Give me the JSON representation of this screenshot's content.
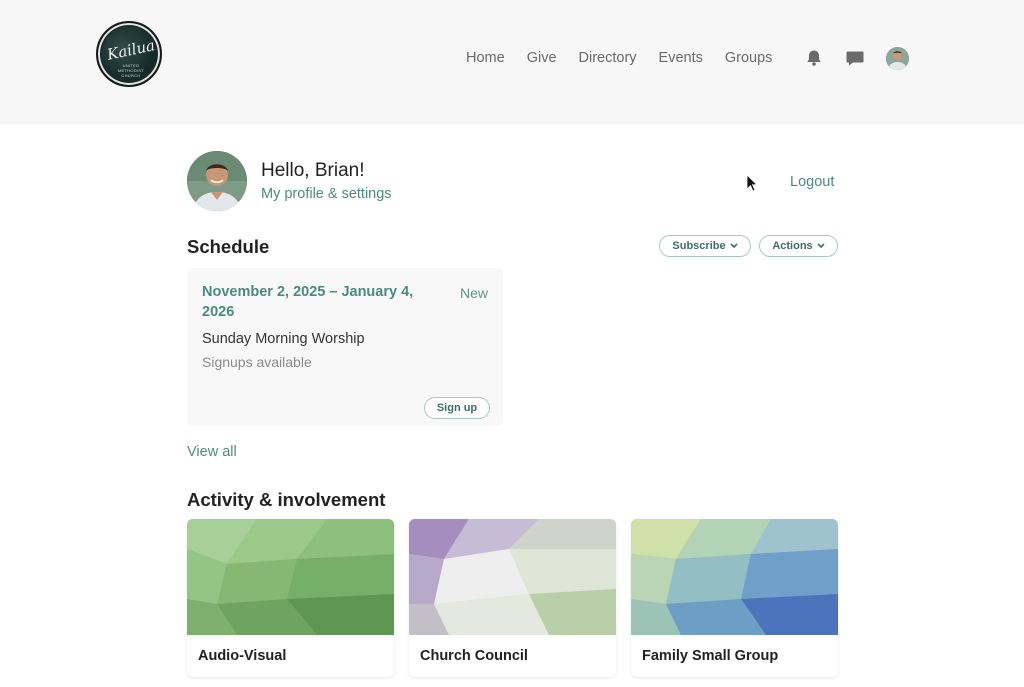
{
  "logo": {
    "text": "Kailua",
    "subtext": "UNITED METHODIST CHURCH"
  },
  "nav": {
    "items": [
      {
        "label": "Home"
      },
      {
        "label": "Give"
      },
      {
        "label": "Directory"
      },
      {
        "label": "Events"
      },
      {
        "label": "Groups"
      }
    ],
    "icons": [
      "bell-icon",
      "chat-icon",
      "user-avatar"
    ]
  },
  "profile": {
    "greeting": "Hello, Brian!",
    "settings_link": "My profile & settings",
    "logout": "Logout"
  },
  "schedule": {
    "title": "Schedule",
    "subscribe_label": "Subscribe",
    "actions_label": "Actions",
    "card": {
      "date_range": "November 2, 2025 – January 4, 2026",
      "badge": "New",
      "name": "Sunday Morning Worship",
      "status": "Signups available",
      "button": "Sign up"
    },
    "view_all": "View all"
  },
  "activity": {
    "title": "Activity & involvement",
    "groups": [
      {
        "name": "Audio-Visual"
      },
      {
        "name": "Church Council"
      },
      {
        "name": "Family Small Group"
      }
    ]
  },
  "colors": {
    "accent": "#4c8a82",
    "pill_border": "#a9c7c2",
    "topbar_bg": "#f7f7f7"
  }
}
